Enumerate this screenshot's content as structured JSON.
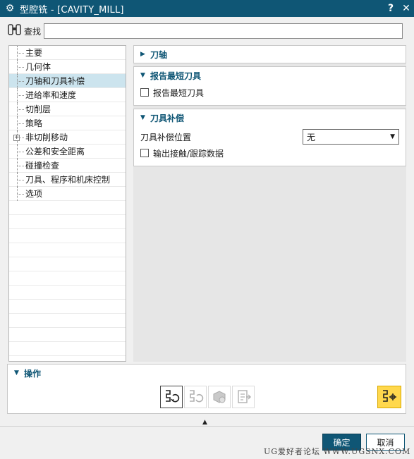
{
  "window": {
    "title": "型腔铣 - [CAVITY_MILL]",
    "help_label": "?",
    "close_label": "✕"
  },
  "search": {
    "label": "查找",
    "value": ""
  },
  "tree": {
    "items": [
      {
        "label": "主要",
        "expandable": false,
        "selected": false
      },
      {
        "label": "几何体",
        "expandable": false,
        "selected": false
      },
      {
        "label": "刀轴和刀具补偿",
        "expandable": false,
        "selected": true
      },
      {
        "label": "进给率和速度",
        "expandable": false,
        "selected": false
      },
      {
        "label": "切削层",
        "expandable": false,
        "selected": false
      },
      {
        "label": "策略",
        "expandable": false,
        "selected": false
      },
      {
        "label": "非切削移动",
        "expandable": true,
        "selected": false
      },
      {
        "label": "公差和安全距离",
        "expandable": false,
        "selected": false
      },
      {
        "label": "碰撞检查",
        "expandable": false,
        "selected": false
      },
      {
        "label": "刀具、程序和机床控制",
        "expandable": false,
        "selected": false
      },
      {
        "label": "选项",
        "expandable": false,
        "selected": false
      }
    ]
  },
  "groups": {
    "tool_axis": {
      "title": "刀轴",
      "expanded": false
    },
    "report_shortest": {
      "title": "报告最短刀具",
      "expanded": true,
      "checkbox_label": "报告最短刀具",
      "checked": false
    },
    "cutter_comp": {
      "title": "刀具补偿",
      "expanded": true,
      "position_label": "刀具补偿位置",
      "position_value": "无",
      "output_label": "输出接触/跟踪数据",
      "output_checked": false
    }
  },
  "operations": {
    "title": "操作"
  },
  "footer": {
    "ok_label": "确定",
    "cancel_label": "取消"
  },
  "watermark": "UG爱好者论坛 WWW.UGSNX.COM",
  "colors": {
    "accent": "#0f5675",
    "selection": "#cce4ee",
    "highlight": "#ffd84d"
  }
}
